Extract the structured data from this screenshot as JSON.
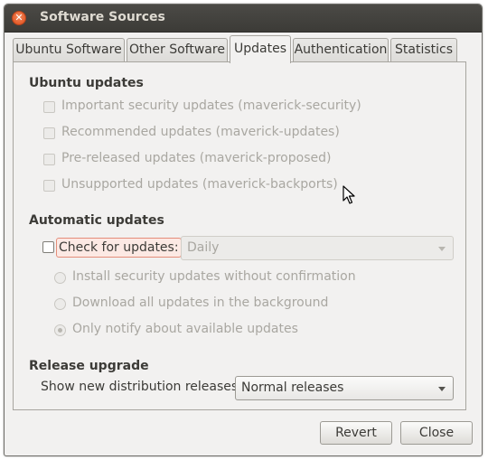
{
  "window": {
    "title": "Software Sources"
  },
  "tabs": [
    {
      "label": "Ubuntu Software",
      "active": false
    },
    {
      "label": "Other Software",
      "active": false
    },
    {
      "label": "Updates",
      "active": true
    },
    {
      "label": "Authentication",
      "active": false
    },
    {
      "label": "Statistics",
      "active": false
    }
  ],
  "ubuntu_updates": {
    "title": "Ubuntu updates",
    "items": [
      {
        "label": "Important security updates (maverick-security)",
        "checked": false,
        "enabled": false
      },
      {
        "label": "Recommended updates (maverick-updates)",
        "checked": false,
        "enabled": false
      },
      {
        "label": "Pre-released updates (maverick-proposed)",
        "checked": false,
        "enabled": false
      },
      {
        "label": "Unsupported updates (maverick-backports)",
        "checked": false,
        "enabled": false
      }
    ]
  },
  "automatic_updates": {
    "title": "Automatic updates",
    "check_label": "Check for updates:",
    "check_checked": false,
    "interval_value": "Daily",
    "options": [
      {
        "label": "Install security updates without confirmation",
        "selected": false
      },
      {
        "label": "Download all updates in the background",
        "selected": false
      },
      {
        "label": "Only notify about available updates",
        "selected": true
      }
    ]
  },
  "release_upgrade": {
    "title": "Release upgrade",
    "show_label": "Show new distribution releases:",
    "value": "Normal releases"
  },
  "buttons": {
    "revert": "Revert",
    "close": "Close"
  },
  "colors": {
    "titlebar": "#3c3b37",
    "highlight": "#df4a17",
    "window_bg": "#f2f1f0"
  }
}
